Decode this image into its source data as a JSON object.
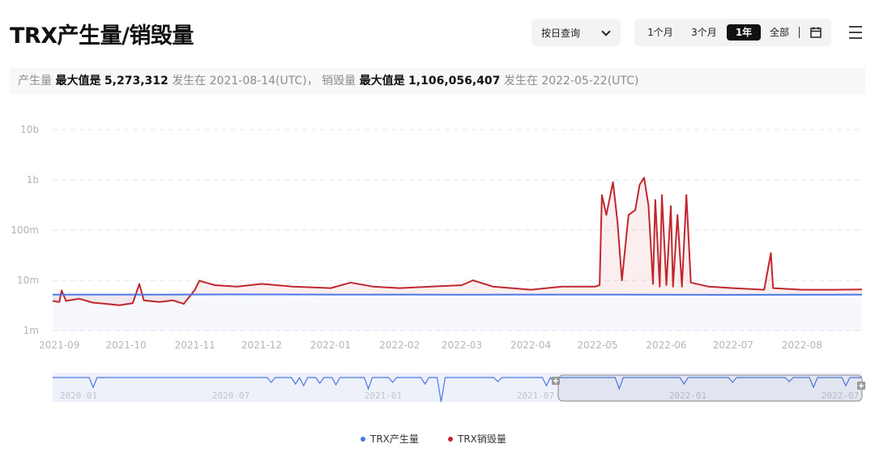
{
  "header": {
    "title": "TRX产生量/销毁量",
    "mode_select": "按日查询",
    "ranges": [
      "1个月",
      "3个月",
      "1年",
      "全部"
    ],
    "active_range": "1年"
  },
  "info": {
    "mint_label": "产生量",
    "max_label": "最大值是",
    "mint_max": "5,273,312",
    "occur_label": "发生在",
    "mint_date": "2021-08-14(UTC)",
    "sep": "，",
    "burn_label": "销毁量",
    "burn_max": "1,106,056,407",
    "burn_date": "2022-05-22(UTC)"
  },
  "colors": {
    "mint": "#4a78e8",
    "burn": "#c0272d",
    "grid": "#e6e6e6"
  },
  "chart_data": {
    "type": "line",
    "y_scale": "log",
    "y_ticks": [
      "1m",
      "10m",
      "100m",
      "1b",
      "10b"
    ],
    "y_tick_values": [
      1000000,
      10000000,
      100000000,
      1000000000,
      10000000000
    ],
    "x_ticks": [
      "2021-09",
      "2021-10",
      "2021-11",
      "2021-12",
      "2022-01",
      "2022-02",
      "2022-03",
      "2022-04",
      "2022-05",
      "2022-06",
      "2022-07",
      "2022-08"
    ],
    "x_range": [
      "2021-08-29",
      "2022-08-28"
    ],
    "series": [
      {
        "name": "TRX产生量",
        "color": "#4a78e8",
        "points": [
          [
            "2021-08-29",
            5200000
          ],
          [
            "2021-10-15",
            5200000
          ],
          [
            "2021-11-15",
            5250000
          ],
          [
            "2022-01-01",
            5200000
          ],
          [
            "2022-03-01",
            5180000
          ],
          [
            "2022-05-01",
            5200000
          ],
          [
            "2022-07-01",
            5150000
          ],
          [
            "2022-08-28",
            5200000
          ]
        ]
      },
      {
        "name": "TRX销毁量",
        "color": "#c0272d",
        "points": [
          [
            "2021-08-29",
            3900000
          ],
          [
            "2021-09-01",
            3700000
          ],
          [
            "2021-09-02",
            6300000
          ],
          [
            "2021-09-04",
            3900000
          ],
          [
            "2021-09-10",
            4300000
          ],
          [
            "2021-09-16",
            3600000
          ],
          [
            "2021-09-22",
            3400000
          ],
          [
            "2021-09-28",
            3200000
          ],
          [
            "2021-10-04",
            3500000
          ],
          [
            "2021-10-07",
            8500000
          ],
          [
            "2021-10-09",
            4000000
          ],
          [
            "2021-10-16",
            3700000
          ],
          [
            "2021-10-22",
            4000000
          ],
          [
            "2021-10-27",
            3400000
          ],
          [
            "2021-11-01",
            6500000
          ],
          [
            "2021-11-03",
            9800000
          ],
          [
            "2021-11-10",
            8000000
          ],
          [
            "2021-11-20",
            7500000
          ],
          [
            "2021-12-01",
            8500000
          ],
          [
            "2021-12-15",
            7500000
          ],
          [
            "2022-01-01",
            7000000
          ],
          [
            "2022-01-10",
            9000000
          ],
          [
            "2022-01-20",
            7500000
          ],
          [
            "2022-02-01",
            7000000
          ],
          [
            "2022-02-15",
            7500000
          ],
          [
            "2022-03-01",
            8000000
          ],
          [
            "2022-03-06",
            10000000
          ],
          [
            "2022-03-15",
            7500000
          ],
          [
            "2022-04-01",
            6500000
          ],
          [
            "2022-04-15",
            7500000
          ],
          [
            "2022-04-30",
            7500000
          ],
          [
            "2022-05-02",
            8000000
          ],
          [
            "2022-05-03",
            500000000
          ],
          [
            "2022-05-05",
            200000000
          ],
          [
            "2022-05-08",
            900000000
          ],
          [
            "2022-05-10",
            150000000
          ],
          [
            "2022-05-12",
            10000000
          ],
          [
            "2022-05-15",
            200000000
          ],
          [
            "2022-05-18",
            250000000
          ],
          [
            "2022-05-20",
            800000000
          ],
          [
            "2022-05-22",
            1106056407
          ],
          [
            "2022-05-24",
            300000000
          ],
          [
            "2022-05-26",
            8500000
          ],
          [
            "2022-05-27",
            400000000
          ],
          [
            "2022-05-29",
            7500000
          ],
          [
            "2022-05-30",
            500000000
          ],
          [
            "2022-06-01",
            8000000
          ],
          [
            "2022-06-03",
            300000000
          ],
          [
            "2022-06-04",
            7500000
          ],
          [
            "2022-06-06",
            200000000
          ],
          [
            "2022-06-08",
            7500000
          ],
          [
            "2022-06-10",
            500000000
          ],
          [
            "2022-06-12",
            9000000
          ],
          [
            "2022-06-20",
            7500000
          ],
          [
            "2022-07-01",
            7000000
          ],
          [
            "2022-07-15",
            6500000
          ],
          [
            "2022-07-18",
            35000000
          ],
          [
            "2022-07-19",
            7000000
          ],
          [
            "2022-08-01",
            6500000
          ],
          [
            "2022-08-15",
            6500000
          ],
          [
            "2022-08-28",
            6600000
          ]
        ]
      }
    ]
  },
  "navigator": {
    "labels": [
      "2020-01",
      "2020-07",
      "2021-01",
      "2021-07",
      "2022-01",
      "2022-07"
    ]
  }
}
